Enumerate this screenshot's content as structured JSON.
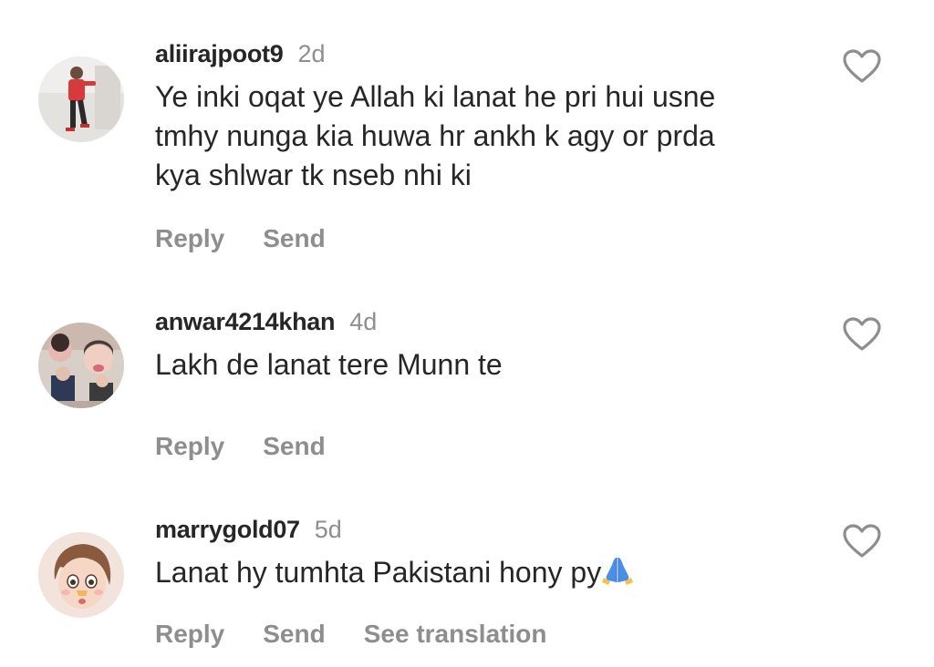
{
  "comments": [
    {
      "username": "aliirajpoot9",
      "age": "2d",
      "line1": "Ye inki oqat ye Allah ki lanat he pri hui usne",
      "line2": "tmhy nunga kia huwa hr ankh k agy or prda",
      "line3": "kya shlwar tk nseb nhi ki",
      "reply": "Reply",
      "send": "Send"
    },
    {
      "username": "anwar4214khan",
      "age": "4d",
      "text": "Lakh de lanat tere Munn te",
      "reply": "Reply",
      "send": "Send"
    },
    {
      "username": "marrygold07",
      "age": "5d",
      "text": "Lanat hy tumhta Pakistani hony py",
      "emoji": "folded-hands",
      "reply": "Reply",
      "send": "Send",
      "translate": "See translation"
    }
  ],
  "colors": {
    "text": "#262626",
    "muted": "#8e8e8e",
    "background": "#ffffff"
  }
}
